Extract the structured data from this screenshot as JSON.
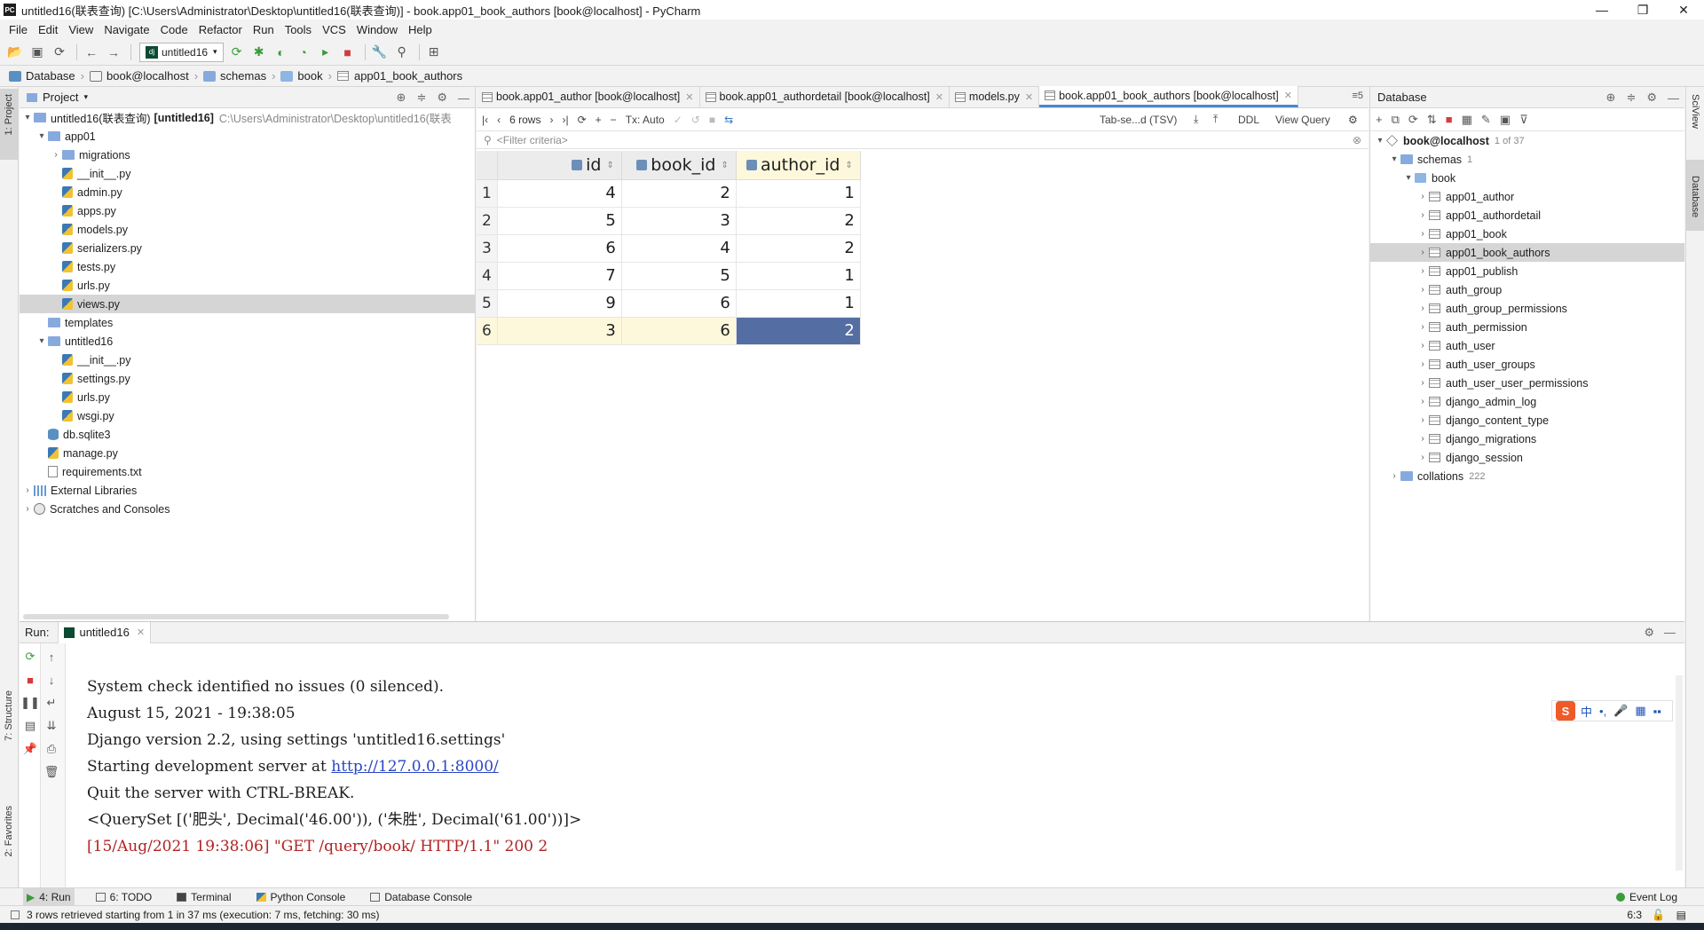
{
  "window": {
    "title": "untitled16(联表查询) [C:\\Users\\Administrator\\Desktop\\untitled16(联表查询)] - book.app01_book_authors [book@localhost] - PyCharm",
    "controls": [
      "—",
      "❐",
      "✕"
    ]
  },
  "menu": [
    "File",
    "Edit",
    "View",
    "Navigate",
    "Code",
    "Refactor",
    "Run",
    "Tools",
    "VCS",
    "Window",
    "Help"
  ],
  "toolbar": {
    "run_config": "untitled16"
  },
  "breadcrumb": [
    "Database",
    "book@localhost",
    "schemas",
    "book",
    "app01_book_authors"
  ],
  "project_panel": {
    "title": "Project",
    "tree": [
      {
        "indent": 0,
        "arrow": "▾",
        "icon": "folder",
        "label": "untitled16(联表查询)",
        "bold_suffix": "[untitled16]",
        "hint": "C:\\Users\\Administrator\\Desktop\\untitled16(联表"
      },
      {
        "indent": 1,
        "arrow": "▾",
        "icon": "folder",
        "label": "app01"
      },
      {
        "indent": 2,
        "arrow": "›",
        "icon": "folder",
        "label": "migrations"
      },
      {
        "indent": 2,
        "arrow": "",
        "icon": "py",
        "label": "__init__.py"
      },
      {
        "indent": 2,
        "arrow": "",
        "icon": "py",
        "label": "admin.py"
      },
      {
        "indent": 2,
        "arrow": "",
        "icon": "py",
        "label": "apps.py"
      },
      {
        "indent": 2,
        "arrow": "",
        "icon": "py",
        "label": "models.py"
      },
      {
        "indent": 2,
        "arrow": "",
        "icon": "py",
        "label": "serializers.py"
      },
      {
        "indent": 2,
        "arrow": "",
        "icon": "py",
        "label": "tests.py"
      },
      {
        "indent": 2,
        "arrow": "",
        "icon": "py",
        "label": "urls.py"
      },
      {
        "indent": 2,
        "arrow": "",
        "icon": "py",
        "label": "views.py",
        "selected": true
      },
      {
        "indent": 1,
        "arrow": "",
        "icon": "folder",
        "label": "templates"
      },
      {
        "indent": 1,
        "arrow": "▾",
        "icon": "folder",
        "label": "untitled16"
      },
      {
        "indent": 2,
        "arrow": "",
        "icon": "py",
        "label": "__init__.py"
      },
      {
        "indent": 2,
        "arrow": "",
        "icon": "py",
        "label": "settings.py"
      },
      {
        "indent": 2,
        "arrow": "",
        "icon": "py",
        "label": "urls.py"
      },
      {
        "indent": 2,
        "arrow": "",
        "icon": "py",
        "label": "wsgi.py"
      },
      {
        "indent": 1,
        "arrow": "",
        "icon": "db",
        "label": "db.sqlite3"
      },
      {
        "indent": 1,
        "arrow": "",
        "icon": "py",
        "label": "manage.py"
      },
      {
        "indent": 1,
        "arrow": "",
        "icon": "txt",
        "label": "requirements.txt"
      },
      {
        "indent": 0,
        "arrow": "›",
        "icon": "lib",
        "label": "External Libraries"
      },
      {
        "indent": 0,
        "arrow": "›",
        "icon": "scratch",
        "label": "Scratches and Consoles"
      }
    ]
  },
  "editor_tabs": [
    {
      "label": "book.app01_author [book@localhost]",
      "active": false
    },
    {
      "label": "book.app01_authordetail [book@localhost]",
      "active": false
    },
    {
      "label": "models.py",
      "active": false
    },
    {
      "label": "book.app01_book_authors [book@localhost]",
      "active": true
    }
  ],
  "tabs_overflow": "≡5",
  "grid_toolbar": {
    "rows": "6 rows",
    "tx": "Tx: Auto",
    "export": "Tab-se...d (TSV)",
    "ddl": "DDL",
    "view_query": "View Query"
  },
  "filter_placeholder": "<Filter criteria>",
  "table": {
    "columns": [
      "id",
      "book_id",
      "author_id"
    ],
    "rows": [
      {
        "n": "1",
        "cells": [
          "4",
          "2",
          "1"
        ]
      },
      {
        "n": "2",
        "cells": [
          "5",
          "3",
          "2"
        ]
      },
      {
        "n": "3",
        "cells": [
          "6",
          "4",
          "2"
        ]
      },
      {
        "n": "4",
        "cells": [
          "7",
          "5",
          "1"
        ]
      },
      {
        "n": "5",
        "cells": [
          "9",
          "6",
          "1"
        ]
      },
      {
        "n": "6",
        "cells": [
          "3",
          "6",
          "2"
        ]
      }
    ],
    "current_row": 5,
    "selected_col": 2
  },
  "db_panel": {
    "title": "Database",
    "host": "book@localhost",
    "host_count": "1 of 37",
    "schemas_label": "schemas",
    "schemas_count": "1",
    "schema": "book",
    "tables": [
      "app01_author",
      "app01_authordetail",
      "app01_book",
      "app01_book_authors",
      "app01_publish",
      "auth_group",
      "auth_group_permissions",
      "auth_permission",
      "auth_user",
      "auth_user_groups",
      "auth_user_user_permissions",
      "django_admin_log",
      "django_content_type",
      "django_migrations",
      "django_session"
    ],
    "selected_table": "app01_book_authors",
    "collations": "collations",
    "collations_count": "222"
  },
  "run_panel": {
    "label": "Run:",
    "tab": "untitled16",
    "console_lines": [
      {
        "text": "System check identified no issues (0 silenced).",
        "kind": "normal"
      },
      {
        "text": "August 15, 2021 - 19:38:05",
        "kind": "normal"
      },
      {
        "text": "Django version 2.2, using settings 'untitled16.settings'",
        "kind": "normal"
      },
      {
        "prefix": "Starting development server at ",
        "link": "http://127.0.0.1:8000/",
        "kind": "link"
      },
      {
        "text": "Quit the server with CTRL-BREAK.",
        "kind": "normal"
      },
      {
        "text": "<QuerySet [('肥头', Decimal('46.00')), ('朱胜', Decimal('61.00'))]>",
        "kind": "normal"
      },
      {
        "text": "[15/Aug/2021 19:38:06] \"GET /query/book/ HTTP/1.1\" 200 2",
        "kind": "err"
      }
    ]
  },
  "ime": {
    "logo": "S",
    "items": [
      "中",
      "•,",
      "🎤",
      "▦",
      "▪▪"
    ]
  },
  "side_labels": {
    "project": "1: Project",
    "structure": "7: Structure",
    "favorites": "2: Favorites",
    "sciview": "SciView",
    "database": "Database"
  },
  "bottom_tabs": [
    "4: Run",
    "6: TODO",
    "Terminal",
    "Python Console",
    "Database Console"
  ],
  "event_log": "Event Log",
  "status": {
    "message": "3 rows retrieved starting from 1 in 37 ms (execution: 7 ms, fetching: 30 ms)",
    "position": "6:3"
  }
}
